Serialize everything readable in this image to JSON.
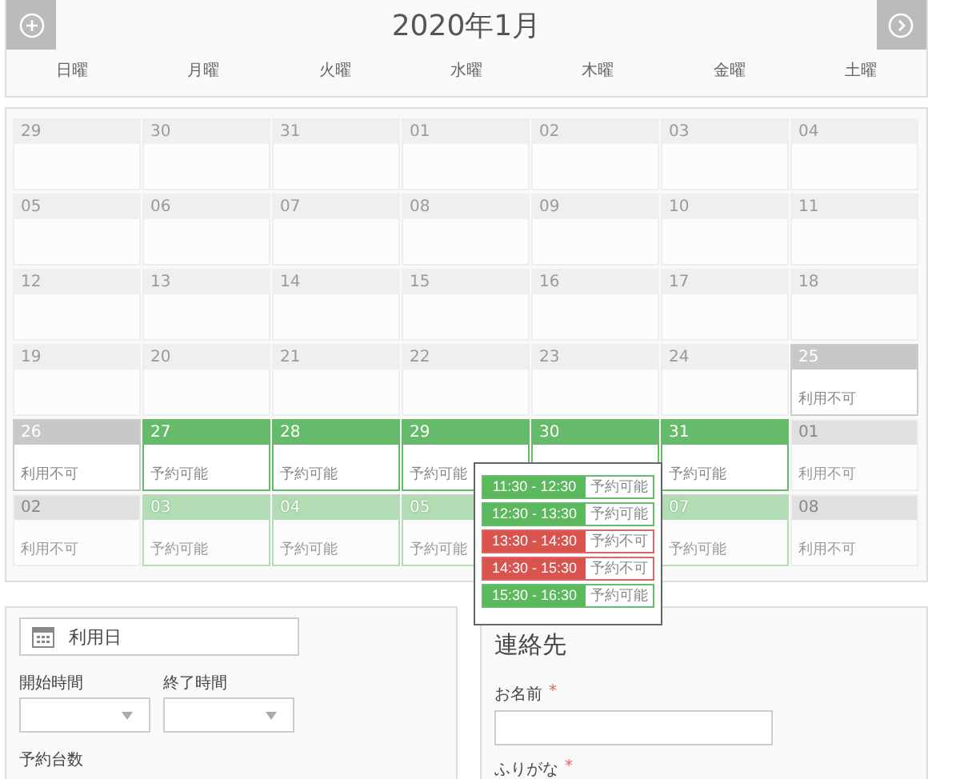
{
  "header": {
    "title": "2020年1月",
    "weekdays": [
      "日曜",
      "月曜",
      "火曜",
      "水曜",
      "木曜",
      "金曜",
      "土曜"
    ]
  },
  "calendar": {
    "weeks": [
      [
        {
          "day": "29",
          "kind": "past"
        },
        {
          "day": "30",
          "kind": "past"
        },
        {
          "day": "31",
          "kind": "past"
        },
        {
          "day": "01",
          "kind": "past"
        },
        {
          "day": "02",
          "kind": "past"
        },
        {
          "day": "03",
          "kind": "past"
        },
        {
          "day": "04",
          "kind": "past"
        }
      ],
      [
        {
          "day": "05",
          "kind": "past"
        },
        {
          "day": "06",
          "kind": "past"
        },
        {
          "day": "07",
          "kind": "past"
        },
        {
          "day": "08",
          "kind": "past"
        },
        {
          "day": "09",
          "kind": "past"
        },
        {
          "day": "10",
          "kind": "past"
        },
        {
          "day": "11",
          "kind": "past"
        }
      ],
      [
        {
          "day": "12",
          "kind": "past"
        },
        {
          "day": "13",
          "kind": "past"
        },
        {
          "day": "14",
          "kind": "past"
        },
        {
          "day": "15",
          "kind": "past"
        },
        {
          "day": "16",
          "kind": "past"
        },
        {
          "day": "17",
          "kind": "past"
        },
        {
          "day": "18",
          "kind": "past"
        }
      ],
      [
        {
          "day": "19",
          "kind": "past"
        },
        {
          "day": "20",
          "kind": "past"
        },
        {
          "day": "21",
          "kind": "past"
        },
        {
          "day": "22",
          "kind": "past"
        },
        {
          "day": "23",
          "kind": "past"
        },
        {
          "day": "24",
          "kind": "past"
        },
        {
          "day": "25",
          "kind": "closed",
          "status": "利用不可"
        }
      ],
      [
        {
          "day": "26",
          "kind": "closed",
          "status": "利用不可"
        },
        {
          "day": "27",
          "kind": "open",
          "status": "予約可能"
        },
        {
          "day": "28",
          "kind": "open",
          "status": "予約可能"
        },
        {
          "day": "29",
          "kind": "open",
          "status": "予約可能"
        },
        {
          "day": "30",
          "kind": "open"
        },
        {
          "day": "31",
          "kind": "open",
          "status": "予約可能"
        },
        {
          "day": "01",
          "kind": "other_closed",
          "status": "利用不可"
        }
      ],
      [
        {
          "day": "02",
          "kind": "other_closed",
          "status": "利用不可"
        },
        {
          "day": "03",
          "kind": "other_open",
          "status": "予約可能"
        },
        {
          "day": "04",
          "kind": "other_open",
          "status": "予約可能"
        },
        {
          "day": "05",
          "kind": "other_open",
          "status": "予約可能"
        },
        {
          "kind": "hidden"
        },
        {
          "day": "07",
          "kind": "other_open",
          "status": "予約可能"
        },
        {
          "day": "08",
          "kind": "other_closed",
          "status": "利用不可"
        }
      ]
    ]
  },
  "popup": {
    "slots": [
      {
        "time": "11:30 - 12:30",
        "status": "予約可能",
        "available": true
      },
      {
        "time": "12:30 - 13:30",
        "status": "予約可能",
        "available": true
      },
      {
        "time": "13:30 - 14:30",
        "status": "予約不可",
        "available": false
      },
      {
        "time": "14:30 - 15:30",
        "status": "予約不可",
        "available": false
      },
      {
        "time": "15:30 - 16:30",
        "status": "予約可能",
        "available": true
      }
    ]
  },
  "booking": {
    "date_placeholder": "利用日",
    "start_label": "開始時間",
    "end_label": "終了時間",
    "count_label": "予約台数"
  },
  "contact": {
    "title": "連絡先",
    "fields": [
      {
        "kind": "text_input",
        "label": "お名前",
        "required_mark": "*"
      },
      {
        "kind": "label_only",
        "label": "ふりがな",
        "required_mark": "*"
      }
    ]
  }
}
